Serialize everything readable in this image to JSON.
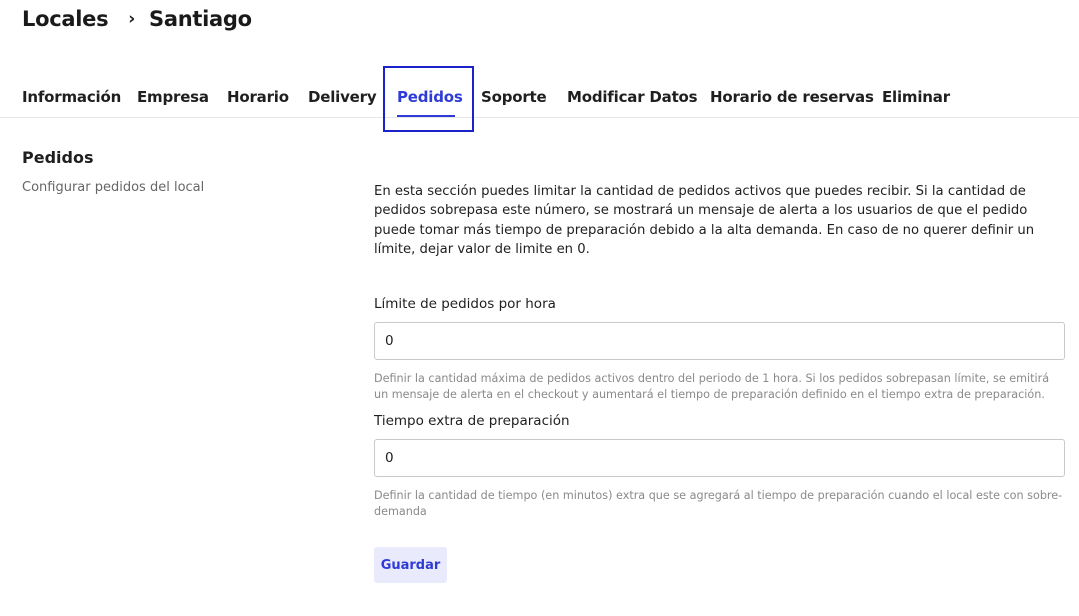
{
  "breadcrumb": {
    "root": "Locales",
    "separator": "›",
    "current": "Santiago"
  },
  "tabs": [
    {
      "label": "Información",
      "active": false
    },
    {
      "label": "Empresa",
      "active": false
    },
    {
      "label": "Horario",
      "active": false
    },
    {
      "label": "Delivery",
      "active": false
    },
    {
      "label": "Pedidos",
      "active": true
    },
    {
      "label": "Soporte",
      "active": false
    },
    {
      "label": "Modificar Datos",
      "active": false
    },
    {
      "label": "Horario de reservas",
      "active": false
    },
    {
      "label": "Eliminar",
      "active": false
    }
  ],
  "section": {
    "title": "Pedidos",
    "subtitle": "Configurar pedidos del local"
  },
  "intro": "En esta sección puedes limitar la cantidad de pedidos activos que puedes recibir. Si la cantidad de pedidos sobrepasa este número, se mostrará un mensaje de alerta a los usuarios de que el pedido puede tomar más tiempo de preparación debido a la alta demanda. En caso de no querer definir un límite, dejar valor de limite en 0.",
  "fields": {
    "limit": {
      "label": "Límite de pedidos por hora",
      "value": "0",
      "help": "Definir la cantidad máxima de pedidos activos dentro del periodo de 1 hora. Si los pedidos sobrepasan límite, se emitirá un mensaje de alerta en el checkout y aumentará el tiempo de preparación definido en el tiempo extra de preparación."
    },
    "extra_time": {
      "label": "Tiempo extra de preparación",
      "value": "0",
      "help": "Definir la cantidad de tiempo (en minutos) extra que se agregará al tiempo de preparación cuando el local este con sobre-demanda"
    }
  },
  "actions": {
    "save_label": "Guardar"
  },
  "colors": {
    "accent": "#2f3bd6",
    "focus_outline": "#1c22c9",
    "button_bg": "#e9eafb"
  }
}
